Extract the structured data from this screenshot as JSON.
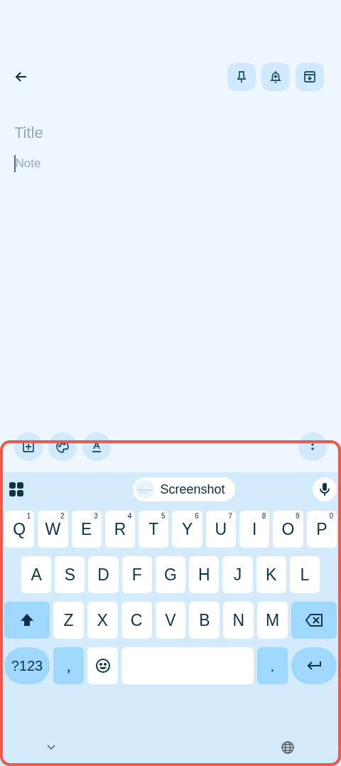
{
  "header": {
    "actions": [
      {
        "kind": "pin"
      },
      {
        "kind": "reminder"
      },
      {
        "kind": "archive"
      }
    ]
  },
  "editor": {
    "title_placeholder": "Title",
    "note_placeholder": "Note",
    "cursor": true
  },
  "toolbar": {
    "left": [
      {
        "kind": "add"
      },
      {
        "kind": "palette"
      },
      {
        "kind": "format"
      }
    ],
    "right": [
      {
        "kind": "more"
      }
    ]
  },
  "keyboard": {
    "suggestion": {
      "label": "Screenshot",
      "kind": "picture"
    },
    "rows": [
      {
        "keys": [
          {
            "kind": "letter",
            "label": "Q",
            "hint": "1"
          },
          {
            "kind": "letter",
            "label": "W",
            "hint": "2"
          },
          {
            "kind": "letter",
            "label": "E",
            "hint": "3"
          },
          {
            "kind": "letter",
            "label": "R",
            "hint": "4"
          },
          {
            "kind": "letter",
            "label": "T",
            "hint": "5"
          },
          {
            "kind": "letter",
            "label": "Y",
            "hint": "6"
          },
          {
            "kind": "letter",
            "label": "U",
            "hint": "7"
          },
          {
            "kind": "letter",
            "label": "I",
            "hint": "8"
          },
          {
            "kind": "letter",
            "label": "O",
            "hint": "9"
          },
          {
            "kind": "letter",
            "label": "P",
            "hint": "0"
          }
        ]
      },
      {
        "keys": [
          {
            "kind": "letter",
            "label": "A"
          },
          {
            "kind": "letter",
            "label": "S"
          },
          {
            "kind": "letter",
            "label": "D"
          },
          {
            "kind": "letter",
            "label": "F"
          },
          {
            "kind": "letter",
            "label": "G"
          },
          {
            "kind": "letter",
            "label": "H"
          },
          {
            "kind": "letter",
            "label": "J"
          },
          {
            "kind": "letter",
            "label": "K"
          },
          {
            "kind": "letter",
            "label": "L"
          }
        ]
      },
      {
        "keys": [
          {
            "kind": "shift"
          },
          {
            "kind": "letter",
            "label": "Z"
          },
          {
            "kind": "letter",
            "label": "X"
          },
          {
            "kind": "letter",
            "label": "C"
          },
          {
            "kind": "letter",
            "label": "V"
          },
          {
            "kind": "letter",
            "label": "B"
          },
          {
            "kind": "letter",
            "label": "N"
          },
          {
            "kind": "letter",
            "label": "M"
          },
          {
            "kind": "backspace"
          }
        ]
      },
      {
        "keys": [
          {
            "kind": "symbols",
            "label": "?123"
          },
          {
            "kind": "punct",
            "label": ","
          },
          {
            "kind": "emoji"
          },
          {
            "kind": "space"
          },
          {
            "kind": "punct",
            "label": "."
          },
          {
            "kind": "enter"
          }
        ]
      }
    ]
  },
  "highlight_frame": true
}
